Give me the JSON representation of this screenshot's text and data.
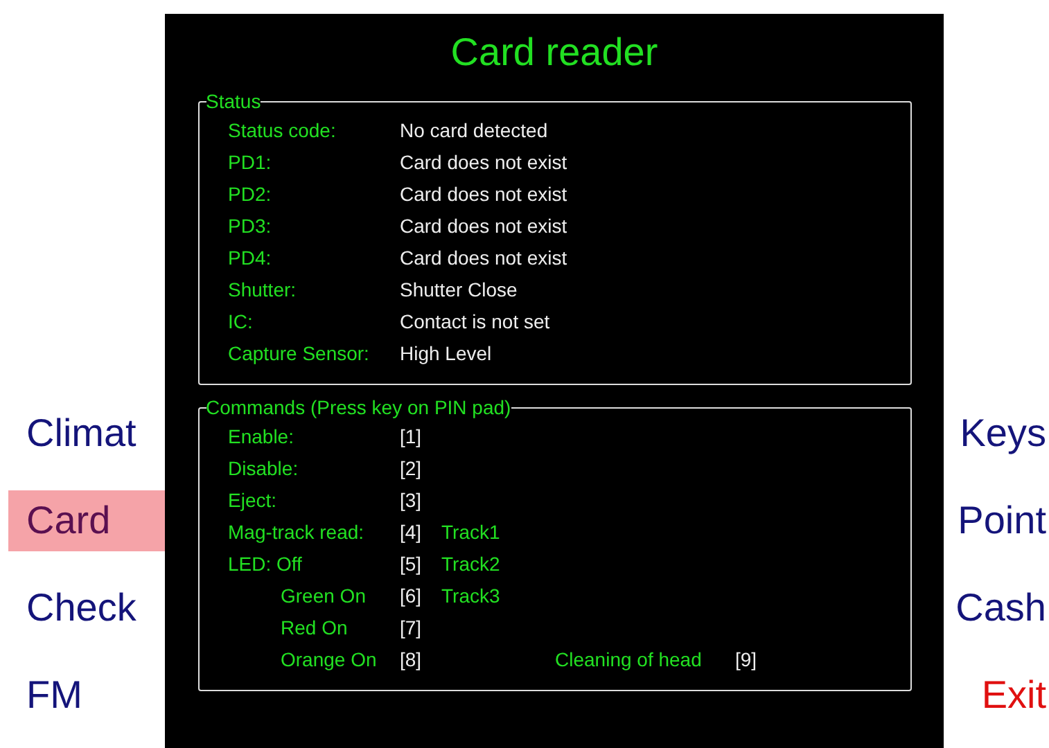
{
  "title": "Card reader",
  "left_menu": [
    {
      "label": "Climat",
      "selected": false,
      "kind": "nav"
    },
    {
      "label": "Card",
      "selected": true,
      "kind": "nav"
    },
    {
      "label": "Check",
      "selected": false,
      "kind": "nav"
    },
    {
      "label": "FM",
      "selected": false,
      "kind": "nav"
    }
  ],
  "right_menu": [
    {
      "label": "Keys",
      "selected": false,
      "kind": "nav"
    },
    {
      "label": "Point",
      "selected": false,
      "kind": "nav"
    },
    {
      "label": "Cash",
      "selected": false,
      "kind": "nav"
    },
    {
      "label": "Exit",
      "selected": false,
      "kind": "exit"
    }
  ],
  "status": {
    "title": "Status",
    "rows": [
      {
        "label": "Status code:",
        "value": "No card detected"
      },
      {
        "label": "PD1:",
        "value": "Card does not exist"
      },
      {
        "label": "PD2:",
        "value": "Card does not exist"
      },
      {
        "label": "PD3:",
        "value": "Card does not exist"
      },
      {
        "label": "PD4:",
        "value": "Card does not exist"
      },
      {
        "label": "Shutter:",
        "value": "Shutter Close"
      },
      {
        "label": "IC:",
        "value": "Contact is not set"
      },
      {
        "label": "Capture Sensor:",
        "value": "High Level"
      }
    ]
  },
  "commands": {
    "title": "Commands (Press key on PIN pad)",
    "rows": [
      {
        "label": "Enable:",
        "key": "[1]"
      },
      {
        "label": "Disable:",
        "key": "[2]"
      },
      {
        "label": "Eject:",
        "key": "[3]"
      },
      {
        "label": "Mag-track read:",
        "key": "[4]",
        "extra": "Track1"
      },
      {
        "label": "LED: Off",
        "key": "[5]",
        "extra": "Track2",
        "children": [
          {
            "label": "Green On",
            "key": "[6]",
            "extra": "Track3"
          },
          {
            "label": "Red On",
            "key": "[7]"
          },
          {
            "label": "Orange On",
            "key": "[8]",
            "side": {
              "label": "Cleaning of head",
              "key": "[9]"
            }
          }
        ]
      }
    ]
  }
}
